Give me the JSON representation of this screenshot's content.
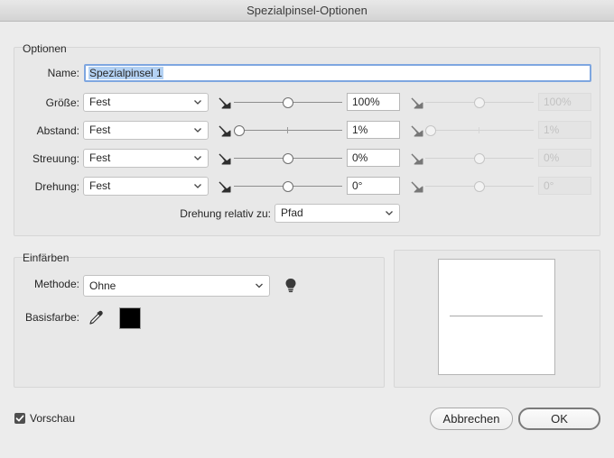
{
  "window": {
    "title": "Spezialpinsel-Optionen"
  },
  "options": {
    "group_title": "Optionen",
    "name": {
      "label": "Name:",
      "value": "Spezialpinsel 1"
    },
    "rows": [
      {
        "label": "Größe:",
        "method": "Fest",
        "value": "100%",
        "value_disabled": "100%",
        "slider": 0.5,
        "slider_disabled": 0.5
      },
      {
        "label": "Abstand:",
        "method": "Fest",
        "value": "1%",
        "value_disabled": "1%",
        "slider": 0.0,
        "slider_disabled": 0.0
      },
      {
        "label": "Streuung:",
        "method": "Fest",
        "value": "0%",
        "value_disabled": "0%",
        "slider": 0.5,
        "slider_disabled": 0.5
      },
      {
        "label": "Drehung:",
        "method": "Fest",
        "value": "0°",
        "value_disabled": "0°",
        "slider": 0.5,
        "slider_disabled": 0.5
      }
    ],
    "rotation_relative": {
      "label": "Drehung relativ zu:",
      "value": "Pfad"
    }
  },
  "colorize": {
    "group_title": "Einfärben",
    "method": {
      "label": "Methode:",
      "value": "Ohne"
    },
    "key_color": {
      "label": "Basisfarbe:",
      "color": "#000000"
    },
    "icons": {
      "tip": "lightbulb-icon",
      "picker": "eyedropper-icon"
    }
  },
  "preview": {
    "label": "Vorschau",
    "checked": true
  },
  "buttons": {
    "cancel": "Abbrechen",
    "ok": "OK"
  },
  "colors": {
    "accent": "#7ea6e0",
    "selection": "#b3d1f3"
  }
}
